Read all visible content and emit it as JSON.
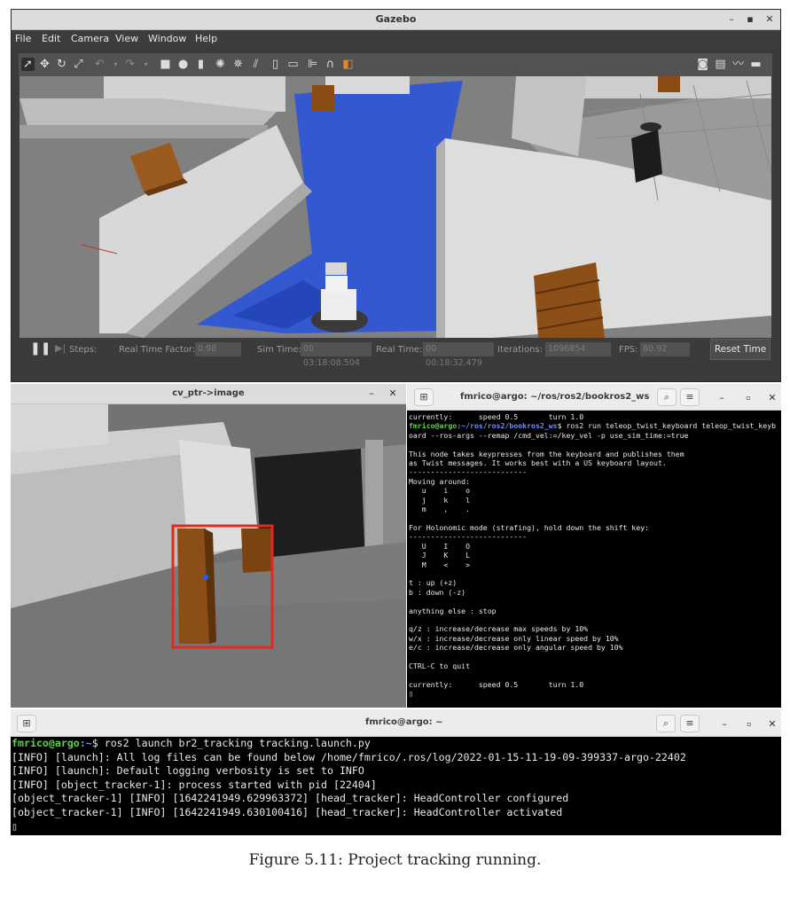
{
  "gazebo": {
    "title": "Gazebo",
    "menu": [
      "File",
      "Edit",
      "Camera",
      "View",
      "Window",
      "Help"
    ],
    "status": {
      "steps_label": "Steps:",
      "rtf_label": "Real Time Factor:",
      "rtf_value": "0.98",
      "sim_time_label": "Sim Time:",
      "sim_time_value": "00 03:18:08.504",
      "real_time_label": "Real Time:",
      "real_time_value": "00 00:18:32.479",
      "iterations_label": "Iterations:",
      "iterations_value": "1096854",
      "fps_label": "FPS:",
      "fps_value": "60.92",
      "reset_label": "Reset Time"
    }
  },
  "image_view": {
    "title": "cv_ptr->image"
  },
  "terminal_teleop": {
    "title": "fmrico@argo: ~/ros/ros2/bookros2_ws",
    "lines": [
      "currently:      speed 0.5       turn 1.0",
      "oard --ros-args --remap /cmd_vel:=/key_vel -p use_sim_time:=true",
      "",
      "This node takes keypresses from the keyboard and publishes them",
      "as Twist messages. It works best with a US keyboard layout.",
      "---------------------------",
      "Moving around:",
      "   u    i    o",
      "   j    k    l",
      "   m    ,    .",
      "",
      "For Holonomic mode (strafing), hold down the shift key:",
      "---------------------------",
      "   U    I    O",
      "   J    K    L",
      "   M    <    >",
      "",
      "t : up (+z)",
      "b : down (-z)",
      "",
      "anything else : stop",
      "",
      "q/z : increase/decrease max speeds by 10%",
      "w/x : increase/decrease only linear speed by 10%",
      "e/c : increase/decrease only angular speed by 10%",
      "",
      "CTRL-C to quit",
      "",
      "currently:      speed 0.5       turn 1.0"
    ],
    "prompt_user": "fmrico@argo",
    "prompt_path": ":~/ros/ros2/bookros2_ws",
    "prompt_cmd": "$ ros2 run teleop_twist_keyboard teleop_twist_keyb"
  },
  "terminal_launch": {
    "title": "fmrico@argo: ~",
    "prompt_user": "fmrico@argo",
    "prompt_path": ":~",
    "prompt_cmd": "$ ros2 launch br2_tracking tracking.launch.py",
    "lines": [
      "[INFO] [launch]: All log files can be found below /home/fmrico/.ros/log/2022-01-15-11-19-09-399337-argo-22402",
      "[INFO] [launch]: Default logging verbosity is set to INFO",
      "[INFO] [object_tracker-1]: process started with pid [22404]",
      "[object_tracker-1] [INFO] [1642241949.629963372] [head_tracker]: HeadController configured",
      "[object_tracker-1] [INFO] [1642241949.630100416] [head_tracker]: HeadController activated"
    ]
  },
  "caption": "Figure 5.11: Project tracking running."
}
